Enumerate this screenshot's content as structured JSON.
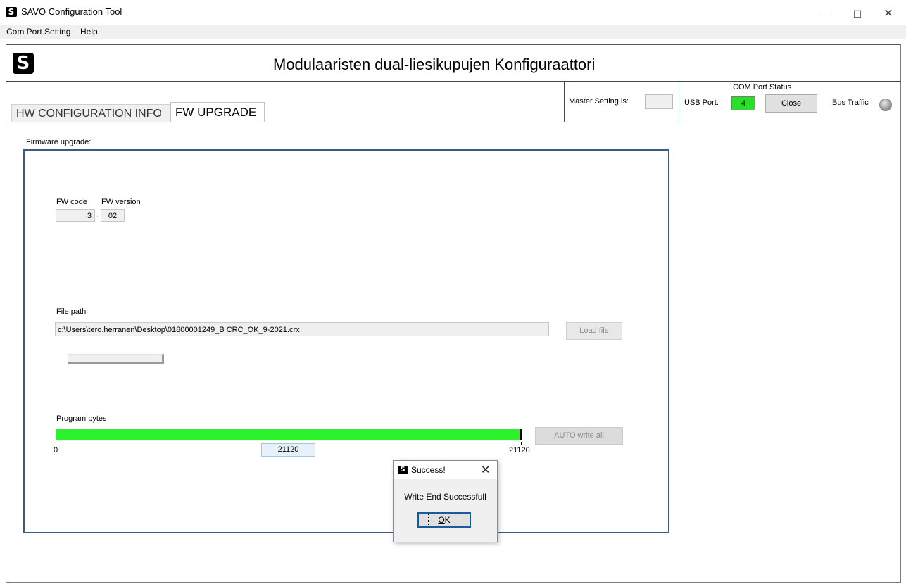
{
  "window": {
    "title": "SAVO Configuration Tool",
    "logo_letter": "S",
    "controls": {
      "minimize": "—",
      "maximize": "☐",
      "close": "✕"
    }
  },
  "menu": {
    "items": [
      "Com Port Setting",
      "Help"
    ]
  },
  "header": {
    "logo_letter": "S",
    "title": "Modulaaristen dual-liesikupujen Konfiguraattori"
  },
  "status": {
    "master_label": "Master Setting is:",
    "master_value": "",
    "com_port_title": "COM Port Status",
    "usb_label": "USB Port:",
    "usb_port_value": "4",
    "close_button": "Close",
    "bus_traffic_label": "Bus Traffic",
    "colors": {
      "usb_port_bg": "#28e028",
      "bus_led": "#9a9a9a"
    }
  },
  "tabs": [
    {
      "label": "HW CONFIGURATION INFO",
      "active": false
    },
    {
      "label": "FW UPGRADE",
      "active": true
    }
  ],
  "fw_upgrade": {
    "group_label": "Firmware upgrade:",
    "fw_code_label": "FW code",
    "fw_version_label": "FW version",
    "fw_code_value": "3",
    "separator": ".",
    "fw_version_value": "02",
    "file_path_label": "File path",
    "file_path_value": "c:\\Users\\tero.herranen\\Desktop\\01800001249_B CRC_OK_9-2021.crx",
    "load_file_button": "Load file",
    "program_bytes_label": "Program bytes",
    "progress": {
      "min": "0",
      "max": "21120",
      "value": "21120",
      "fraction": 1.0,
      "color": "#2bf22b"
    },
    "auto_write_button": "AUTO write all"
  },
  "dialog": {
    "logo_letter": "S",
    "title": "Success!",
    "close": "✕",
    "message": "Write End Successfull",
    "ok_button": "OK"
  }
}
